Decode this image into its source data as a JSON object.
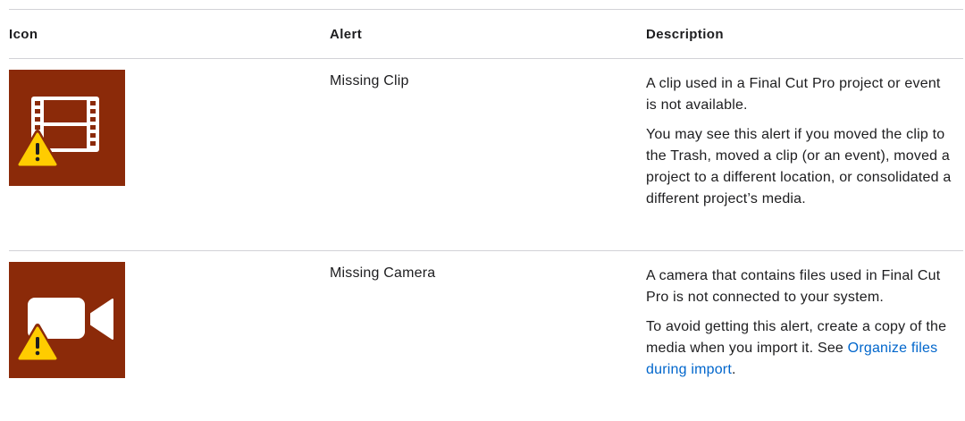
{
  "table": {
    "headers": {
      "icon": "Icon",
      "alert": "Alert",
      "description": "Description"
    },
    "rows": [
      {
        "icon": "missing-clip-icon",
        "alert": "Missing Clip",
        "description": [
          "A clip used in a Final Cut Pro project or event is not available.",
          "You may see this alert if you moved the clip to the Trash, moved a clip (or an event), moved a project to a different location, or consolidated a different project’s media."
        ]
      },
      {
        "icon": "missing-camera-icon",
        "alert": "Missing Camera",
        "description": [
          "A camera that contains files used in Final Cut Pro is not connected to your system."
        ],
        "description_2_prefix": "To avoid getting this alert, create a copy of the media when you import it. See ",
        "description_2_link": "Organize files during import",
        "description_2_suffix": "."
      }
    ]
  },
  "colors": {
    "icon_background": "#8b2a09",
    "warning_yellow": "#ffcc00",
    "link": "#0066cc",
    "rule": "#d2d2d7"
  }
}
